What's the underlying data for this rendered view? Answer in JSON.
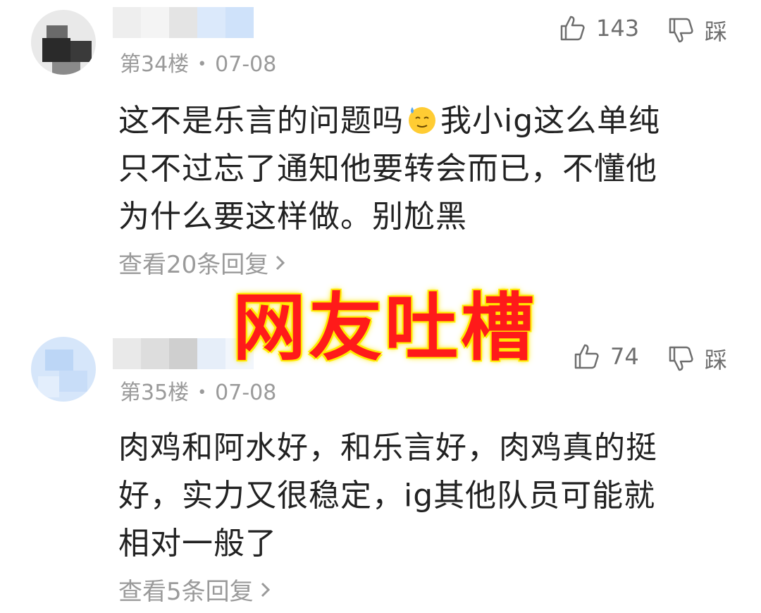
{
  "comments": [
    {
      "floor": "第34楼",
      "date": "07-08",
      "likes": "143",
      "dislike_label": "踩",
      "body_lines": [
        "这不是乐言的问题吗",
        "我小ig这么单纯",
        "只不过忘了通知他要转会而已，不懂他",
        "为什么要这样做。别尬黑"
      ],
      "emoji": "sweat-smile-emoji",
      "replies": "查看20条回复"
    },
    {
      "floor": "第35楼",
      "date": "07-08",
      "likes": "74",
      "dislike_label": "踩",
      "body_lines": [
        "肉鸡和阿水好，和乐言好，肉鸡真的挺",
        "好，实力又很稳定，ig其他队员可能就",
        "相对一般了"
      ],
      "replies": "查看5条回复"
    }
  ],
  "overlay": {
    "title": "网友吐槽"
  },
  "icons": {
    "like": "thumbs-up-icon",
    "dislike": "thumbs-down-icon",
    "chevron": "chevron-right-icon"
  },
  "colors": {
    "overlay_text": "#ff1a1a",
    "overlay_glow": "#ffe600",
    "meta_gray": "#9a9a9a"
  }
}
